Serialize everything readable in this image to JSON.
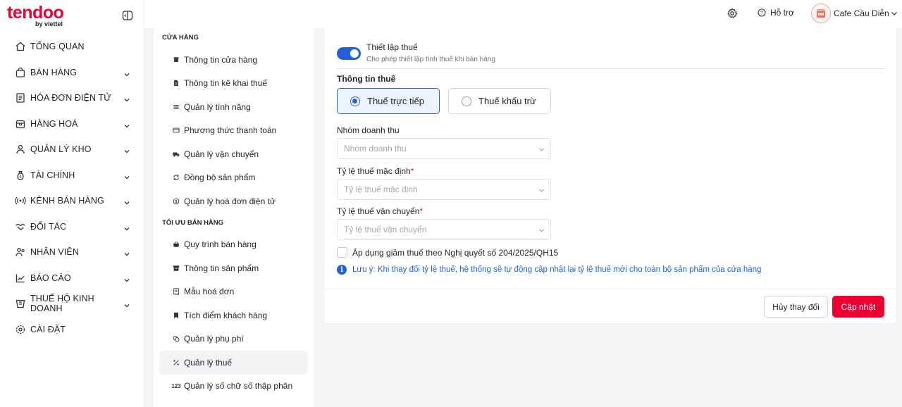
{
  "brand": {
    "logo_text": "tendoo",
    "logo_sub": "by viettel"
  },
  "sidebar": {
    "items": [
      {
        "label": "Tổng quan",
        "icon": "home-icon",
        "expandable": false
      },
      {
        "label": "Bán hàng",
        "icon": "bag-icon",
        "expandable": true
      },
      {
        "label": "Hóa đơn điện tử",
        "icon": "invoice-icon",
        "expandable": true
      },
      {
        "label": "Hàng hoá",
        "icon": "box-icon",
        "expandable": true
      },
      {
        "label": "Quản lý kho",
        "icon": "warehouse-icon",
        "expandable": true
      },
      {
        "label": "Tài chính",
        "icon": "money-bag-icon",
        "expandable": true
      },
      {
        "label": "Kênh bán hàng",
        "icon": "broadcast-icon",
        "expandable": true
      },
      {
        "label": "Đối tác",
        "icon": "handshake-icon",
        "expandable": true
      },
      {
        "label": "Nhân viên",
        "icon": "staff-icon",
        "expandable": true
      },
      {
        "label": "Báo cáo",
        "icon": "chart-icon",
        "expandable": true
      },
      {
        "label": "Thuế hộ kinh doanh",
        "icon": "tax-icon",
        "expandable": true
      },
      {
        "label": "Cài đặt",
        "icon": "gear-icon",
        "expandable": false
      }
    ]
  },
  "topbar": {
    "help_label": "Hỗ trợ",
    "user_name": "Cafe Cầu Diễn"
  },
  "settings_menu": {
    "store_section_title": "CỬA HÀNG",
    "store_items": [
      {
        "label": "Thông tin cửa hàng",
        "icon": "store-icon"
      },
      {
        "label": "Thông tin kê khai thuế",
        "icon": "document-icon"
      },
      {
        "label": "Quản lý tính năng",
        "icon": "menu-lines-icon"
      },
      {
        "label": "Phương thức thanh toán",
        "icon": "card-icon"
      },
      {
        "label": "Quản lý vận chuyển",
        "icon": "truck-icon"
      },
      {
        "label": "Đồng bộ sản phẩm",
        "icon": "sync-icon"
      },
      {
        "label": "Quản lý hoá đơn điện tử",
        "icon": "coin-icon"
      }
    ],
    "optimize_section_title": "TỐI ƯU BÁN HÀNG",
    "optimize_items": [
      {
        "label": "Quy trình bán hàng",
        "icon": "basket-icon"
      },
      {
        "label": "Thông tin sản phẩm",
        "icon": "archive-icon"
      },
      {
        "label": "Mẫu hoá đơn",
        "icon": "receipt-icon"
      },
      {
        "label": "Tích điểm khách hàng",
        "icon": "bookmark-icon"
      },
      {
        "label": "Quản lý phụ phí",
        "icon": "coins-icon"
      },
      {
        "label": "Quản lý thuế",
        "icon": "percent-icon",
        "active": true
      },
      {
        "label": "Quản lý số chữ số thập phân",
        "icon": "number-icon",
        "icon_text": "123"
      }
    ]
  },
  "tax_form": {
    "toggle_title": "Thiết lập thuế",
    "toggle_desc": "Cho phép thiết lập tính thuế khi bán hàng",
    "toggle_on": true,
    "section_title": "Thông tin thuế",
    "radio_direct": "Thuế trực tiếp",
    "radio_deduct": "Thuế khấu trừ",
    "selected_method": "direct",
    "revenue_group_label": "Nhóm doanh thu",
    "revenue_group_placeholder": "Nhóm doanh thu",
    "default_rate_label": "Tỷ lệ thuế mặc định",
    "default_rate_placeholder": "Tỷ lệ thuế mặc định",
    "shipping_rate_label": "Tỷ lệ thuế vận chuyển",
    "shipping_rate_placeholder": "Tỷ lệ thuế vận chuyển",
    "required_mark": "*",
    "checkbox_label": "Áp dụng giảm thuế theo Nghị quyết số 204/2025/QH15",
    "checkbox_checked": false,
    "note_text": "Lưu ý: Khi thay đổi tỷ lệ thuế, hệ thống sẽ tự động cập nhật lại tỷ lệ thuế mới cho toàn bộ sản phẩm của cửa hàng",
    "cancel_label": "Hủy thay đổi",
    "save_label": "Cập nhật"
  },
  "colors": {
    "brand_red": "#ee0033",
    "accent_blue": "#2461d8"
  }
}
